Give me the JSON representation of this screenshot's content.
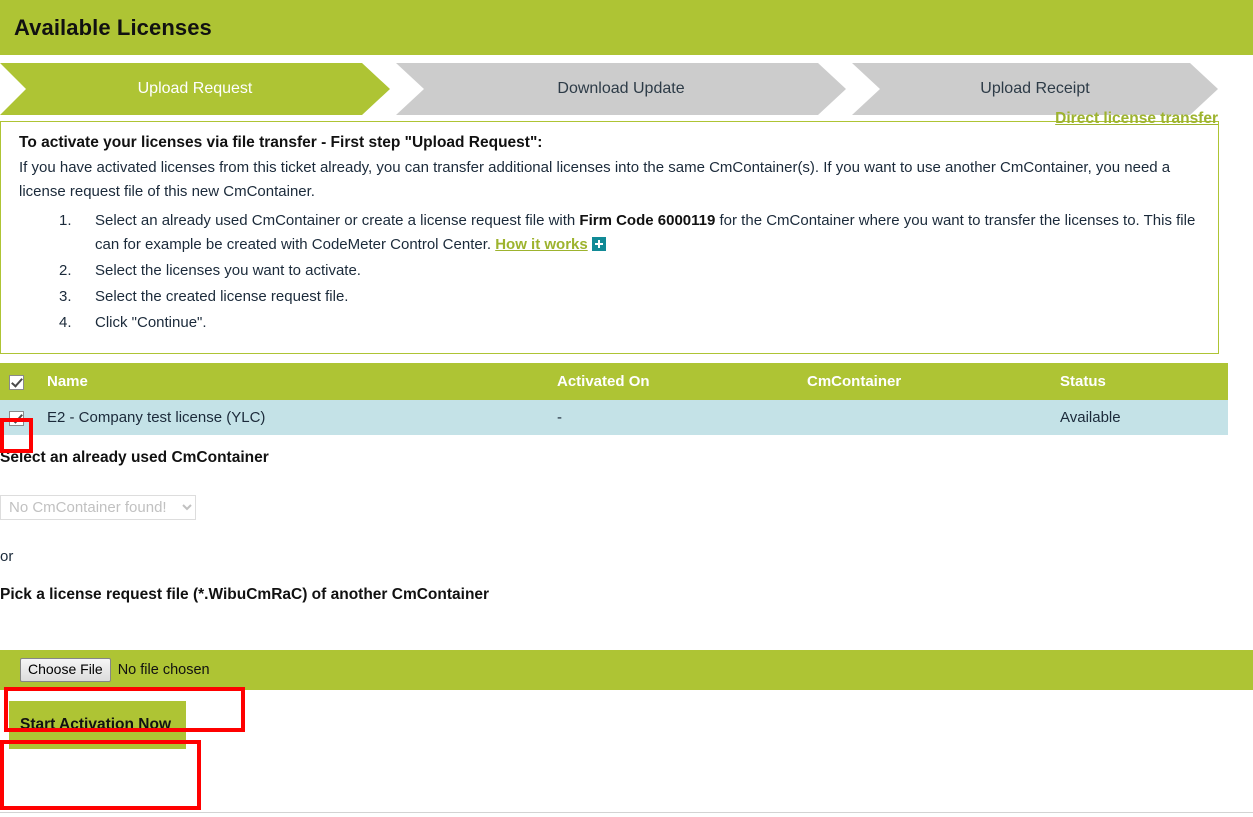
{
  "header": {
    "title": "Available Licenses"
  },
  "steps": [
    {
      "label": "Upload Request",
      "state": "active"
    },
    {
      "label": "Download Update",
      "state": "inactive"
    },
    {
      "label": "Upload Receipt",
      "state": "inactive"
    }
  ],
  "info": {
    "title": "To activate your licenses via file transfer - First step \"Upload Request\":",
    "paragraph_a": "If you have activated licenses from this ticket already, you can transfer additional licenses into the same CmContainer(s). If you want to use another",
    "paragraph_b": "CmContainer, you need a license request file of this new CmContainer.",
    "item1_a": "Select an already used CmContainer or create a license request file with ",
    "item1_bold": "Firm Code 6000119",
    "item1_b": " for the CmContainer where you want to transfer the licenses to. This file can for example be created with CodeMeter Control Center. ",
    "how_it_works": "How it works",
    "item2": "Select the licenses you want to activate.",
    "item3": "Select the created license request file.",
    "item4": "Click \"Continue\"."
  },
  "table": {
    "headers": {
      "name": "Name",
      "activated_on": "Activated On",
      "cmcontainer": "CmContainer",
      "status": "Status"
    },
    "rows": [
      {
        "checked": true,
        "name": "E2 - Company test license (YLC)",
        "activated_on": "-",
        "cmcontainer": "",
        "status": "Available"
      }
    ]
  },
  "select_section": {
    "label": "Select an already used CmContainer",
    "dropdown_value": "No CmContainer found!",
    "or": "or"
  },
  "pick_section": {
    "label": "Pick a license request file (*.WibuCmRaC) of another CmContainer",
    "choose_file_button": "Choose File",
    "no_file_text": "No file chosen"
  },
  "actions": {
    "start_button": "Start Activation Now",
    "direct_link": "Direct license transfer"
  },
  "colors": {
    "brand_green": "#AEC434",
    "row_highlight": "#C4E2E7",
    "step_inactive": "#CCCCCC",
    "link_green": "#9DB32E",
    "badge_teal": "#118A96",
    "annotation_red": "#FF0000"
  }
}
